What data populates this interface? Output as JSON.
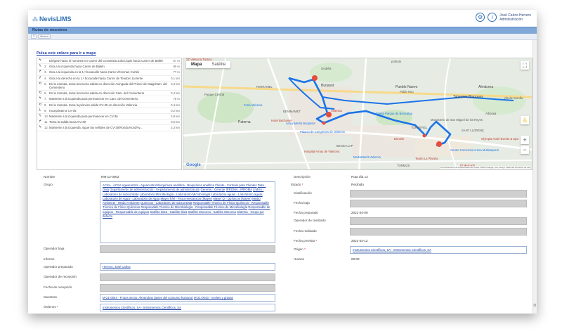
{
  "app": {
    "name": "NevisLIMS",
    "user_name": "José Carlos Herrero",
    "user_role": "Administración"
  },
  "page": {
    "title": "Rutas de muestreo",
    "toolbar_label": "Nuevo",
    "map_link": "Pulsa este enlace para ir a maps"
  },
  "directions": [
    {
      "n": "",
      "icon": "↰",
      "text": "Dirígete hacia el noroeste en Carrer del Ceramista Julio Llopis hacia Carrer de Bailén",
      "dist": "57 m"
    },
    {
      "n": "2.",
      "icon": "↰",
      "text": "Gira a la izquierda hacia Carrer de Bailén",
      "dist": "80 m"
    },
    {
      "n": "3.",
      "icon": "↱",
      "text": "Gira a la izquierda en la 1.ª bocacalle hacia Carrer d'Hernan Cortés",
      "dist": "77 m"
    },
    {
      "n": "4.",
      "icon": "↱",
      "text": "Gira a la derecha en la 1.ª bocacalle hacia Carrer de Teodoro Llorente",
      "dist": "0,1 km"
    },
    {
      "n": "5.",
      "icon": "⟲",
      "text": "En la rotonda, toma la tercera salida en dirección Avinguda del Primer de Maig/Cam. del Cementerio",
      "dist": "0,3 km"
    },
    {
      "n": "6.",
      "icon": "⟲",
      "text": "En la rotonda, toma la tercera salida en dirección Cam. del Cementerio",
      "dist": "0,4 km"
    },
    {
      "n": "7.",
      "icon": "↰",
      "text": "Mantente a la izquierda para permanecer en Cam. del Cementerio",
      "dist": "75 m"
    },
    {
      "n": "8.",
      "icon": "⟲",
      "text": "En la rotonda, toma la primera salida CV-35 en dirección Valencia",
      "dist": "0,4 km"
    },
    {
      "n": "9.",
      "icon": "⅄",
      "text": "Incorpórate a CV-35",
      "dist": "0,2 km"
    },
    {
      "n": "10.",
      "icon": "↰",
      "text": "Mantente a la izquierda para permanecer en CV-35",
      "dist": "2,9 km"
    },
    {
      "n": "11.",
      "icon": "↱",
      "text": "Toma la salida hacia CV-30",
      "dist": "0,5 km"
    },
    {
      "n": "12.",
      "icon": "↰",
      "text": "Mantente a la izquierda, sigue las señales de CV-30/Ronda Nord/Av...",
      "dist": "2,3 km"
    }
  ],
  "map": {
    "tab_map": "Mapa",
    "tab_sat": "Satélite",
    "labels": {
      "valencia_tactical": "ZZ Valencia Táctico",
      "burjassot": "Burjasot",
      "godella": "Godella",
      "parque_central": "Parque Central",
      "feria": "Feria Valencia",
      "ferramel": "FERRAMEL",
      "paterna": "Paterna",
      "hotel_bechamel": "Hotel Bechamel",
      "benimamet": "BENIMAMET",
      "leroy": "Leroy Merlin Burjassot",
      "palacio": "Palacio de Congresos de Valencia",
      "pueblo_nuevo": "Pueblo Nuevo",
      "pueblo_nuevo_sub": "Poble Nou",
      "tabernes": "Tabernes Blanques",
      "almacera": "Almácera",
      "alboraia": "Alboraia",
      "monasterio": "Monasterio de San Miguel de los Reyes",
      "planta": "Planta Parque de Benicalap",
      "torrefiel": "TORREFIEL",
      "benicalap": "BENICALAP",
      "bonaire": "Bonaire",
      "sant_llorenc": "SANT LLORENÇ",
      "olympia": "Olympia Hotel Events & Spa",
      "centro_comercial": "Centro Comercial Arena Multiespacio",
      "teatro": "Teatro La Plazeta",
      "mediamarkt": "MediaMarkt Valencia",
      "hospital": "Hospital Arnau de Vilanova",
      "el_mercado": "El Mercado",
      "torremos": "TORMOS",
      "portoto": "porboto",
      "valencia_pin": "Valencia",
      "vila": "Vila de Sorolla"
    },
    "google": "Google",
    "attribution": "Combinaciones de teclas   Datos del mapa ©2022 Google, Inst. Geogr. Nacional   Términos de uso"
  },
  "form": {
    "nombre_label": "Nombre",
    "nombre_value": "RM-12-0002",
    "grupo_label": "Grupo",
    "grupo_items": [
      "ACSA - ACSA",
      "Aguacontrol - Aguacontrol",
      "Bioquímica analítica - Bioquímica analítica",
      "Cliente - Formulo para Clientes",
      "Data - Data",
      "Departamento de administración - Departamento de administración",
      "Gerente - Gerente",
      "IPROMA - IPROMA",
      "LIMSA - Laboratorio de subcontrata",
      "Laboratorio Microbiología - Laboratorio Microbiología",
      "Laboratorio aguas - Laboratorio aguas",
      "Laboratorio de Agua - Laboratorio de Agua",
      "Mayer F/M - Físico-mecánicos (Mayer)",
      "Mayer Q - Químicos (Mayer)",
      "Medio Ambiente - Medio Ambiente",
      "Químicos - Laboratorio de subcontrata",
      "Responsable Técnico de Físico-Químicos - Responsable Técnico de Físico-Químicos",
      "Responsable Técnico de Microbiología - Responsable Técnico de Microbiología",
      "Responsable de equipos - Responsable de equipos",
      "Satélite Ibiza - Satélite Ibiza",
      "Satélite Menorca - Satélite Menorca",
      "Sistema - Grupo por defecto"
    ],
    "operador_baja_label": "Operador baja",
    "informe_label": "Informe",
    "operador_preparado_label": "Operador preparado",
    "operador_preparado_value": "Herrero, José Carlos",
    "operador_recepcion_label": "Operador de recepción",
    "fecha_recepcion_label": "Fecha de recepción",
    "muestras_label": "Muestras",
    "muestras_items": [
      "M-21-0044 - Frutos secos. Almendras (antes del consumo humano)",
      "M-21-0043 - Aceites y grasas"
    ],
    "ordenes_label": "Órdenes",
    "ordenes_value": "Instrumentos Científicos, SA - Instrumentos Científicos, SA",
    "descripcion_label": "Descripción",
    "descripcion_value": "Ruta día 12",
    "estado_label": "Estado",
    "estado_value": "Recibido",
    "clasificacion_label": "Clasificación",
    "fecha_baja_label": "Fecha baja",
    "fecha_preparado_label": "Fecha preparado",
    "fecha_preparado_value": "2021-04-09",
    "operador_realizado_label": "Operador de realizado",
    "fecha_realizado_label": "Fecha realizado",
    "fecha_prevista_label": "Fecha prevista",
    "fecha_prevista_value": "2021-04-12",
    "origen_label": "Origen",
    "origen_value": "Instrumentos Científicos, SA - Instrumentos Científicos, SA",
    "horario_label": "Horario",
    "horario_value": "00:00",
    "required_mark": "*"
  },
  "corner_letter": "D",
  "colors": {
    "accent": "#2f6fb5",
    "titlebar": "#7fa7d8",
    "route": "#1a73e8",
    "link": "#1a3fa0"
  }
}
